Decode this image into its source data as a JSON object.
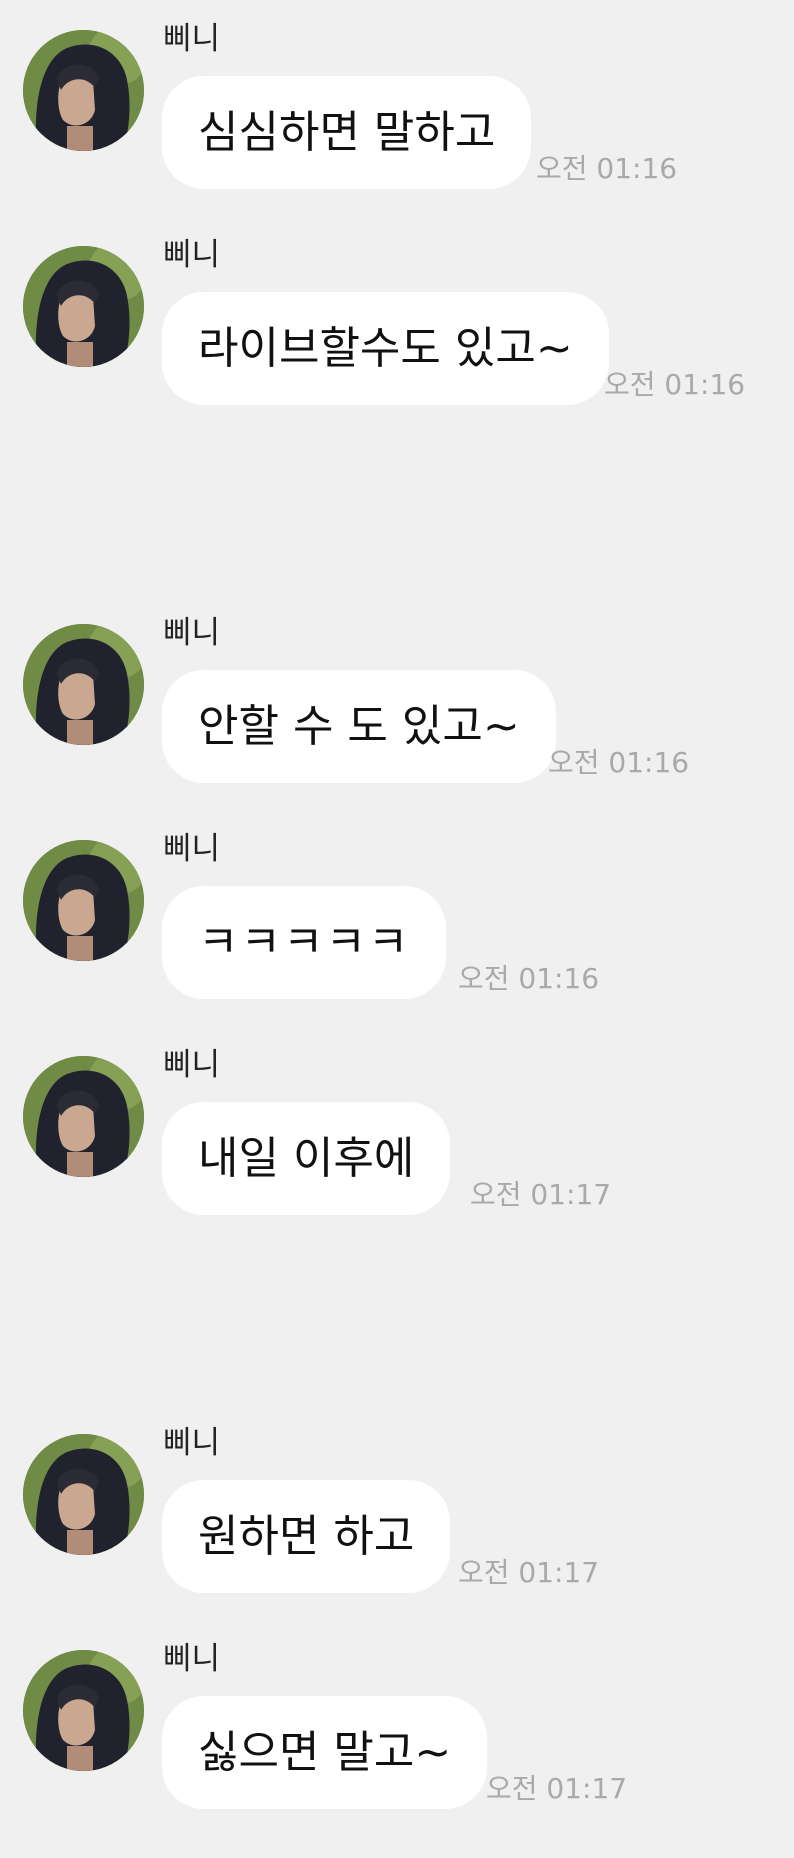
{
  "chat": {
    "messages": [
      {
        "sender": "삐니",
        "text": "심심하면 말하고",
        "time": "오전 01:16"
      },
      {
        "sender": "삐니",
        "text": "라이브할수도 있고~",
        "time": "오전 01:16"
      },
      {
        "sender": "삐니",
        "text": "안할 수 도 있고~",
        "time": "오전 01:16"
      },
      {
        "sender": "삐니",
        "text": "ㅋㅋㅋㅋㅋ",
        "time": "오전 01:16"
      },
      {
        "sender": "삐니",
        "text": "내일 이후에",
        "time": "오전 01:17"
      },
      {
        "sender": "삐니",
        "text": "원하면 하고",
        "time": "오전 01:17"
      },
      {
        "sender": "삐니",
        "text": "싫으면 말고~",
        "time": "오전 01:17"
      }
    ]
  },
  "colors": {
    "background": "#f0f0f0",
    "bubble": "#ffffff",
    "text": "#111111",
    "timestamp": "#a9a9a9"
  },
  "icons": {
    "avatar": "profile-photo-avatar"
  }
}
